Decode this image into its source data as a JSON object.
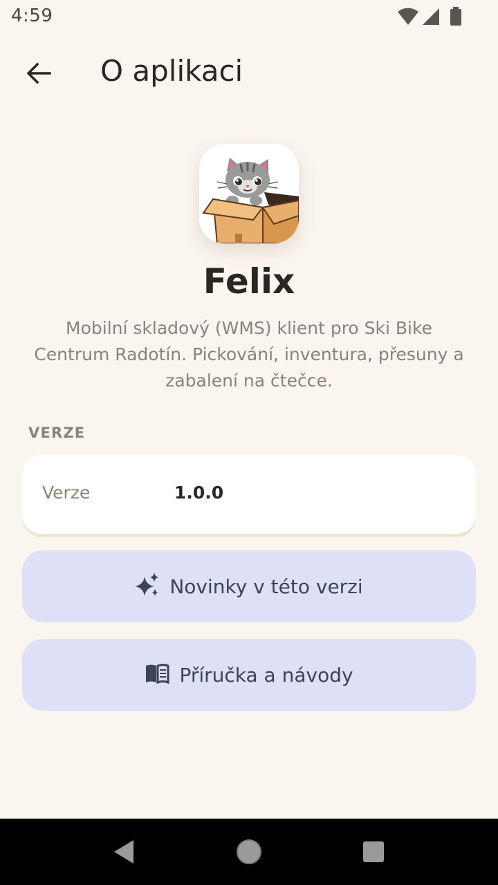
{
  "status_bar": {
    "time": "4:59",
    "icons": [
      "wifi-icon",
      "signal-icon",
      "battery-icon"
    ]
  },
  "app_bar": {
    "title": "O aplikaci",
    "back_icon": "arrow-back-icon"
  },
  "app": {
    "name": "Felix",
    "description": "Mobilní skladový (WMS) klient pro Ski Bike Centrum Radotín. Pickování, inventura, přesuny a zabalení na čtečce.",
    "icon": "cat-in-box-icon"
  },
  "version_section": {
    "label": "VERZE",
    "key": "Verze",
    "value": "1.0.0"
  },
  "buttons": {
    "news_label": "Novinky v této verzi",
    "news_icon": "sparkles-icon",
    "manual_label": "Příručka a návody",
    "manual_icon": "book-icon"
  },
  "nav_bar": {
    "items": [
      "back-triangle-icon",
      "home-circle-icon",
      "recents-square-icon"
    ]
  },
  "colors": {
    "background": "#FAF5EF",
    "card": "#FFFFFF",
    "button": "#DDE0F7",
    "text_primary": "#2B2620",
    "text_secondary": "#8A8278"
  }
}
